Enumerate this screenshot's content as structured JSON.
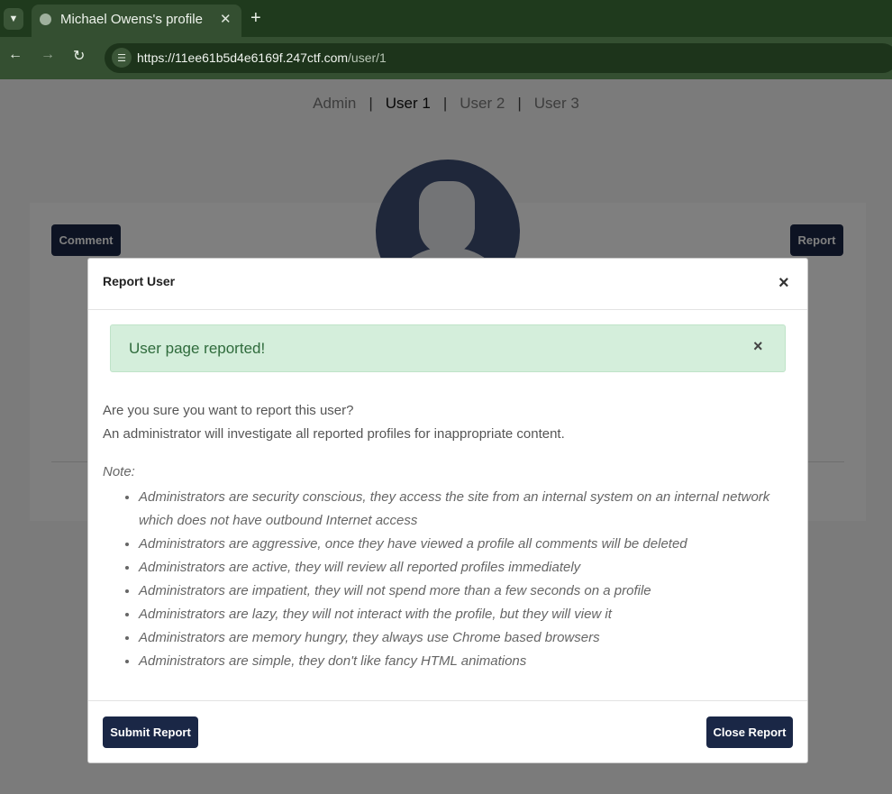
{
  "browser": {
    "tab_title": "Michael Owens's profile",
    "url_host": "https://11ee61b5d4e6169f.247ctf.com",
    "url_path": "/user/1",
    "tab_menu_icon": "chevron-down",
    "new_tab_icon": "plus",
    "close_tab_icon": "x"
  },
  "nav": {
    "links": [
      "Admin",
      "User 1",
      "User 2",
      "User 3"
    ],
    "separator": "|",
    "active_index": 1
  },
  "profile": {
    "comment_label": "Comment",
    "report_label": "Report"
  },
  "modal": {
    "title": "Report User",
    "close_symbol": "×",
    "alert_text": "User page reported!",
    "alert_close_symbol": "×",
    "question": "Are you sure you want to report this user?",
    "explanation": "An administrator will investigate all reported profiles for inappropriate content.",
    "note_label": "Note:",
    "notes": [
      "Administrators are security conscious, they access the site from an internal system on an internal network which does not have outbound Internet access",
      "Administrators are aggressive, once they have viewed a profile all comments will be deleted",
      "Administrators are active, they will review all reported profiles immediately",
      "Administrators are impatient, they will not spend more than a few seconds on a profile",
      "Administrators are lazy, they will not interact with the profile, but they will view it",
      "Administrators are memory hungry, they always use Chrome based browsers",
      "Administrators are simple, they don't like fancy HTML animations"
    ],
    "submit_label": "Submit Report",
    "close_label": "Close Report"
  },
  "colors": {
    "button_dark": "#1a2746",
    "alert_bg": "#d4eedb",
    "alert_text": "#2f6b3c",
    "browser_frame": "#1f3a1d"
  }
}
